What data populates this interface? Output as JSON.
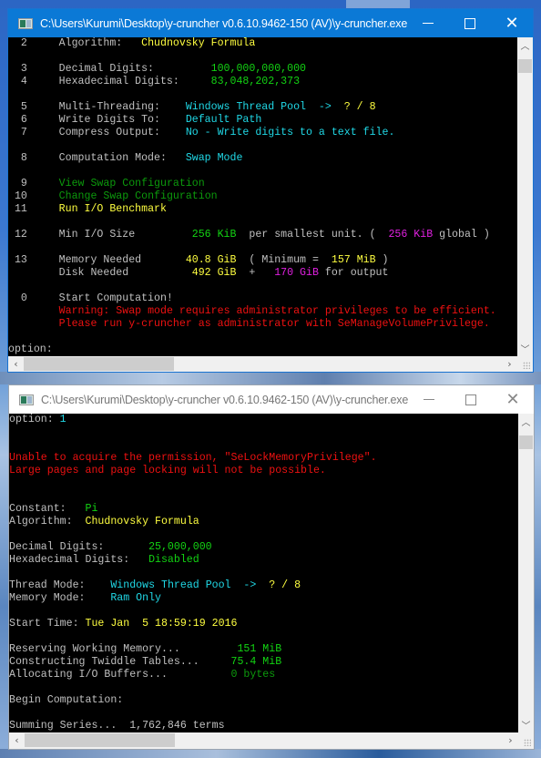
{
  "colors": {
    "active_titlebar": "#0b79d6",
    "inactive_titlebar": "#ffffff",
    "console_bg": "#000000",
    "text_gray": "#c0c0c0",
    "yellow": "#ffff40",
    "green": "#13d313",
    "dark_green": "#0c9a0c",
    "cyan": "#20d8e6",
    "magenta": "#e020e0",
    "red": "#ee1111"
  },
  "windows": [
    {
      "title": "C:\\Users\\Kurumi\\Desktop\\y-cruncher v0.6.10.9462-150 (AV)\\y-cruncher.exe",
      "state": "active",
      "icons": {
        "minimize": "minimize-icon",
        "maximize": "maximize-icon",
        "close": "close-icon",
        "scroll_up": "chevron-up-icon",
        "scroll_down": "chevron-down-icon",
        "scroll_left": "chevron-left-icon",
        "scroll_right": "chevron-right-icon"
      },
      "lines": [
        [
          {
            "t": "  2     Algorithm:   ",
            "c": "w"
          },
          {
            "t": "Chudnovsky Formula",
            "c": "y"
          }
        ],
        [],
        [
          {
            "t": "  3     Decimal Digits:         ",
            "c": "w"
          },
          {
            "t": "100,000,000,000",
            "c": "g"
          }
        ],
        [
          {
            "t": "  4     Hexadecimal Digits:     ",
            "c": "w"
          },
          {
            "t": "83,048,202,373",
            "c": "g"
          }
        ],
        [],
        [
          {
            "t": "  5     Multi-Threading:    ",
            "c": "w"
          },
          {
            "t": "Windows Thread Pool  ->  ",
            "c": "c"
          },
          {
            "t": "? / 8",
            "c": "y"
          }
        ],
        [
          {
            "t": "  6     Write Digits To:    ",
            "c": "w"
          },
          {
            "t": "Default Path",
            "c": "c"
          }
        ],
        [
          {
            "t": "  7     Compress Output:    ",
            "c": "w"
          },
          {
            "t": "No - Write digits to a text file.",
            "c": "c"
          }
        ],
        [],
        [
          {
            "t": "  8     Computation Mode:   ",
            "c": "w"
          },
          {
            "t": "Swap Mode",
            "c": "c"
          }
        ],
        [],
        [
          {
            "t": "  9     ",
            "c": "w"
          },
          {
            "t": "View Swap Configuration",
            "c": "dg"
          }
        ],
        [
          {
            "t": " 10     ",
            "c": "w"
          },
          {
            "t": "Change Swap Configuration",
            "c": "dg"
          }
        ],
        [
          {
            "t": " 11     ",
            "c": "w"
          },
          {
            "t": "Run I/O Benchmark",
            "c": "y"
          }
        ],
        [],
        [
          {
            "t": " 12     Min I/O Size         ",
            "c": "w"
          },
          {
            "t": "256 KiB",
            "c": "g"
          },
          {
            "t": "  per smallest unit. (  ",
            "c": "w"
          },
          {
            "t": "256 KiB",
            "c": "m"
          },
          {
            "t": " global )",
            "c": "w"
          }
        ],
        [],
        [
          {
            "t": " 13     Memory Needed       ",
            "c": "w"
          },
          {
            "t": "40.8 GiB",
            "c": "y"
          },
          {
            "t": "  ( Minimum =  ",
            "c": "w"
          },
          {
            "t": "157 MiB",
            "c": "y"
          },
          {
            "t": " )",
            "c": "w"
          }
        ],
        [
          {
            "t": "        Disk Needed          ",
            "c": "w"
          },
          {
            "t": "492 GiB",
            "c": "y"
          },
          {
            "t": "  +   ",
            "c": "w"
          },
          {
            "t": "170 GiB",
            "c": "m"
          },
          {
            "t": " for output",
            "c": "w"
          }
        ],
        [],
        [
          {
            "t": "  0     Start Computation!",
            "c": "w"
          }
        ],
        [
          {
            "t": "        ",
            "c": "w"
          },
          {
            "t": "Warning: Swap mode requires administrator privileges to be efficient.",
            "c": "r"
          }
        ],
        [
          {
            "t": "        ",
            "c": "w"
          },
          {
            "t": "Please run y-cruncher as administrator with SeManageVolumePrivilege.",
            "c": "r"
          }
        ],
        [],
        [
          {
            "t": "option: ",
            "c": "w"
          }
        ]
      ]
    },
    {
      "title": "C:\\Users\\Kurumi\\Desktop\\y-cruncher v0.6.10.9462-150 (AV)\\y-cruncher.exe",
      "state": "inactive",
      "icons": {
        "minimize": "minimize-icon",
        "maximize": "maximize-icon",
        "close": "close-icon",
        "scroll_up": "chevron-up-icon",
        "scroll_down": "chevron-down-icon",
        "scroll_left": "chevron-left-icon",
        "scroll_right": "chevron-right-icon"
      },
      "lines": [
        [
          {
            "t": "option: ",
            "c": "w"
          },
          {
            "t": "1",
            "c": "c"
          }
        ],
        [],
        [],
        [
          {
            "t": "Unable to acquire the permission, \"SeLockMemoryPrivilege\".",
            "c": "r"
          }
        ],
        [
          {
            "t": "Large pages and page locking will not be possible.",
            "c": "r"
          }
        ],
        [],
        [],
        [
          {
            "t": "Constant:   ",
            "c": "w"
          },
          {
            "t": "Pi",
            "c": "g"
          }
        ],
        [
          {
            "t": "Algorithm:  ",
            "c": "w"
          },
          {
            "t": "Chudnovsky Formula",
            "c": "y"
          }
        ],
        [],
        [
          {
            "t": "Decimal Digits:       ",
            "c": "w"
          },
          {
            "t": "25,000,000",
            "c": "g"
          }
        ],
        [
          {
            "t": "Hexadecimal Digits:   ",
            "c": "w"
          },
          {
            "t": "Disabled",
            "c": "g"
          }
        ],
        [],
        [
          {
            "t": "Thread Mode:    ",
            "c": "w"
          },
          {
            "t": "Windows Thread Pool  ->  ",
            "c": "c"
          },
          {
            "t": "? / 8",
            "c": "y"
          }
        ],
        [
          {
            "t": "Memory Mode:    ",
            "c": "w"
          },
          {
            "t": "Ram Only",
            "c": "c"
          }
        ],
        [],
        [
          {
            "t": "Start Time: ",
            "c": "w"
          },
          {
            "t": "Tue Jan  5 18:59:19 2016",
            "c": "y"
          }
        ],
        [],
        [
          {
            "t": "Reserving Working Memory...         ",
            "c": "w"
          },
          {
            "t": "151 MiB",
            "c": "g"
          }
        ],
        [
          {
            "t": "Constructing Twiddle Tables...     ",
            "c": "w"
          },
          {
            "t": "75.4 MiB",
            "c": "g"
          }
        ],
        [
          {
            "t": "Allocating I/O Buffers...          ",
            "c": "w"
          },
          {
            "t": "0 bytes",
            "c": "dg"
          }
        ],
        [],
        [
          {
            "t": "Begin Computation:",
            "c": "w"
          }
        ],
        [],
        [
          {
            "t": "Summing Series...  1,762,846 terms",
            "c": "w"
          }
        ]
      ]
    }
  ],
  "scroll_glyphs": {
    "up": "︿",
    "down": "﹀",
    "left": "‹",
    "right": "›"
  }
}
